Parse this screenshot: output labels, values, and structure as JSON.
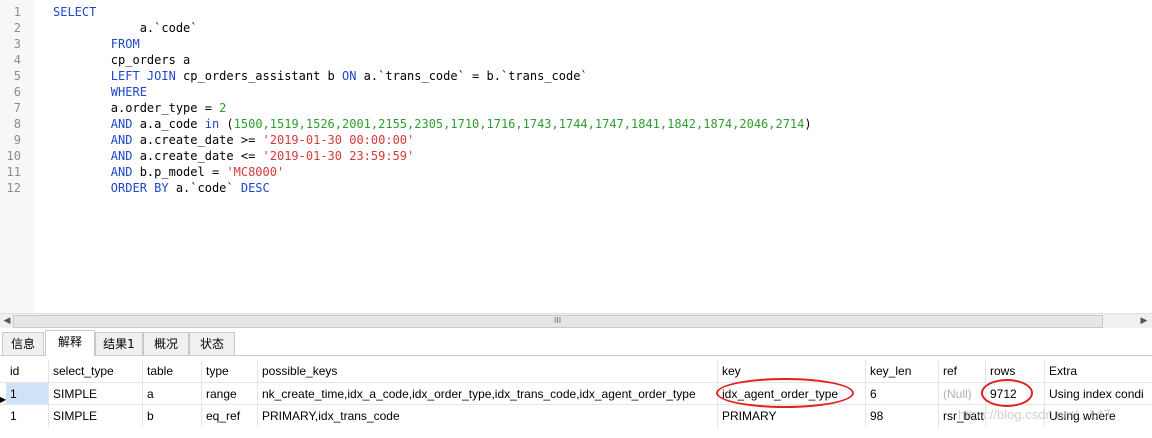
{
  "editor": {
    "lines": [
      {
        "no": "1",
        "tokens": [
          {
            "t": "kw",
            "v": "SELECT"
          }
        ]
      },
      {
        "no": "2",
        "tokens": [
          {
            "t": "plain",
            "v": "            a.`code`"
          }
        ]
      },
      {
        "no": "3",
        "tokens": [
          {
            "t": "plain",
            "v": "        "
          },
          {
            "t": "kw",
            "v": "FROM"
          }
        ]
      },
      {
        "no": "4",
        "tokens": [
          {
            "t": "plain",
            "v": "        cp_orders a"
          }
        ]
      },
      {
        "no": "5",
        "tokens": [
          {
            "t": "plain",
            "v": "        "
          },
          {
            "t": "kw",
            "v": "LEFT JOIN"
          },
          {
            "t": "plain",
            "v": " cp_orders_assistant b "
          },
          {
            "t": "kw",
            "v": "ON"
          },
          {
            "t": "plain",
            "v": " a.`trans_code` = b.`trans_code`"
          }
        ]
      },
      {
        "no": "6",
        "tokens": [
          {
            "t": "plain",
            "v": "        "
          },
          {
            "t": "kw",
            "v": "WHERE"
          }
        ]
      },
      {
        "no": "7",
        "tokens": [
          {
            "t": "plain",
            "v": "        a.order_type = "
          },
          {
            "t": "num",
            "v": "2"
          }
        ]
      },
      {
        "no": "8",
        "tokens": [
          {
            "t": "plain",
            "v": "        "
          },
          {
            "t": "kw",
            "v": "AND"
          },
          {
            "t": "plain",
            "v": " a.a_code "
          },
          {
            "t": "kw",
            "v": "in"
          },
          {
            "t": "plain",
            "v": " ("
          },
          {
            "t": "num",
            "v": "1500,1519,1526,2001,2155,2305,1710,1716,1743,1744,1747,1841,1842,1874,2046,2714"
          },
          {
            "t": "plain",
            "v": ")"
          }
        ]
      },
      {
        "no": "9",
        "tokens": [
          {
            "t": "plain",
            "v": "        "
          },
          {
            "t": "kw",
            "v": "AND"
          },
          {
            "t": "plain",
            "v": " a.create_date >= "
          },
          {
            "t": "str",
            "v": "'2019-01-30 00:00:00'"
          }
        ]
      },
      {
        "no": "10",
        "tokens": [
          {
            "t": "plain",
            "v": "        "
          },
          {
            "t": "kw",
            "v": "AND"
          },
          {
            "t": "plain",
            "v": " a.create_date <= "
          },
          {
            "t": "str",
            "v": "'2019-01-30 23:59:59'"
          }
        ]
      },
      {
        "no": "11",
        "tokens": [
          {
            "t": "plain",
            "v": "        "
          },
          {
            "t": "kw",
            "v": "AND"
          },
          {
            "t": "plain",
            "v": " b.p_model = "
          },
          {
            "t": "str",
            "v": "'MC8000'"
          }
        ]
      },
      {
        "no": "12",
        "tokens": [
          {
            "t": "plain",
            "v": "        "
          },
          {
            "t": "kw",
            "v": "ORDER BY"
          },
          {
            "t": "plain",
            "v": " a.`code` "
          },
          {
            "t": "kw",
            "v": "DESC"
          }
        ]
      }
    ]
  },
  "scrollbar": {
    "left_icon": "◀",
    "right_icon": "▶",
    "grip": "III"
  },
  "tabs": [
    {
      "label": "信息",
      "active": false
    },
    {
      "label": "解释",
      "active": true
    },
    {
      "label": "结果1",
      "active": false
    },
    {
      "label": "概况",
      "active": false
    },
    {
      "label": "状态",
      "active": false
    }
  ],
  "grid": {
    "columns": [
      "id",
      "select_type",
      "table",
      "type",
      "possible_keys",
      "key",
      "key_len",
      "ref",
      "rows",
      "Extra"
    ],
    "rows": [
      [
        "1",
        "SIMPLE",
        "a",
        "range",
        "nk_create_time,idx_a_code,idx_order_type,idx_trans_code,idx_agent_order_type",
        "idx_agent_order_type",
        "6",
        "(Null)",
        "9712",
        "Using index condi"
      ],
      [
        "1",
        "SIMPLE",
        "b",
        "eq_ref",
        "PRIMARY,idx_trans_code",
        "PRIMARY",
        "98",
        "rsr_batt 1",
        "",
        "Using where"
      ]
    ],
    "current_row_marker": "▶"
  },
  "watermark": "https://blog.csdn.net/...147",
  "colors": {
    "keyword": "#1d49c9",
    "number": "#2e9e2e",
    "string": "#d33a3a",
    "annotation": "#e02020"
  }
}
